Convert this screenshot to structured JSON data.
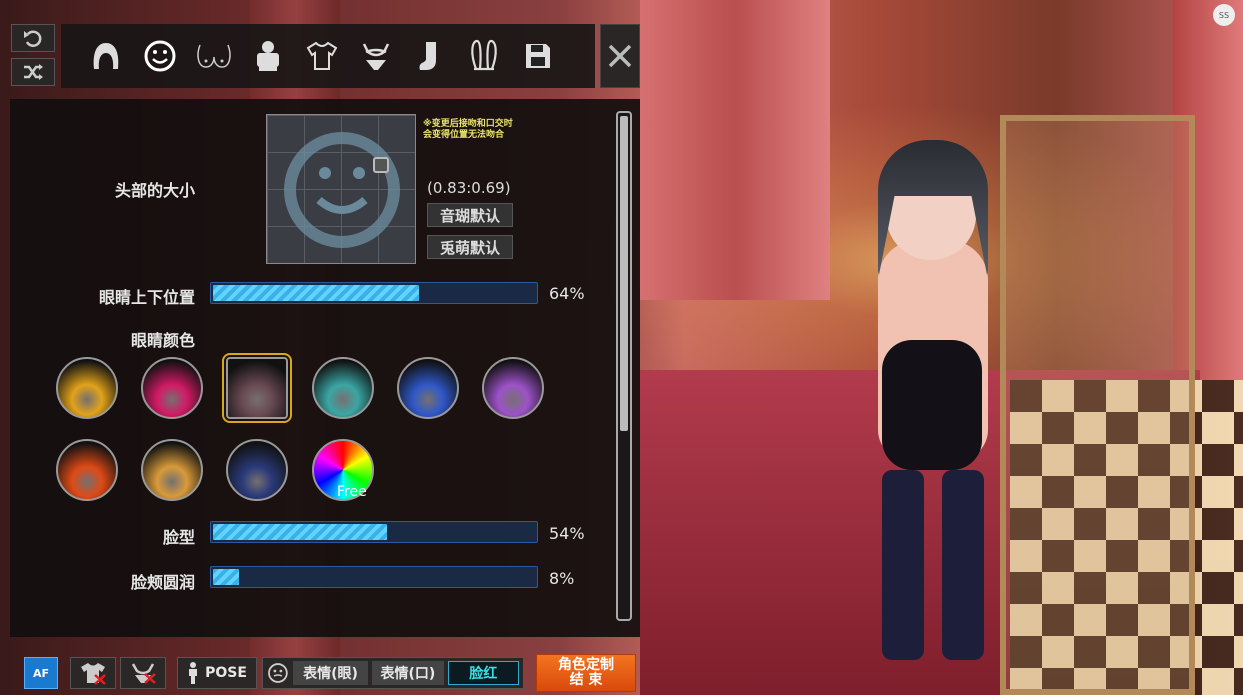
{
  "tabs": [
    {
      "icon": "hair-icon",
      "active": false
    },
    {
      "icon": "face-icon",
      "active": true
    },
    {
      "icon": "chest-icon",
      "active": false
    },
    {
      "icon": "top-icon",
      "active": false
    },
    {
      "icon": "shirt-icon",
      "active": false
    },
    {
      "icon": "bra-icon",
      "active": false
    },
    {
      "icon": "sock-icon",
      "active": false
    },
    {
      "icon": "bunny-ears-icon",
      "active": false
    },
    {
      "icon": "save-icon",
      "active": false
    }
  ],
  "panel": {
    "head_size_label": "头部的大小",
    "note": "※变更后接吻和口交时\n会变得位置无法吻合",
    "coords": "(0.83:0.69)",
    "default_a": "音瑚默认",
    "default_b": "兎萌默认",
    "sliders": [
      {
        "label": "眼睛上下位置",
        "value": 64,
        "pct": "64%"
      },
      {
        "label": "脸型",
        "value": 54,
        "pct": "54%"
      },
      {
        "label": "脸颊圆润",
        "value": 8,
        "pct": "8%"
      }
    ],
    "eye_color_label": "眼睛颜色",
    "eye_colors": [
      "#e2a21a",
      "#d21a66",
      "#6a4a54",
      "#3aa6a4",
      "#2f58c8",
      "#9c52c8",
      "#e04a16",
      "#d89a3a",
      "#2a3a7a"
    ],
    "free_label": "Free"
  },
  "bottom": {
    "af": "AF",
    "pose": "POSE",
    "expr_eye": "表情(眼)",
    "expr_mouth": "表情(口)",
    "blush": "脸红",
    "finish": "角色定制\n结 束"
  },
  "accent": "#f3741f",
  "ss": "SS"
}
